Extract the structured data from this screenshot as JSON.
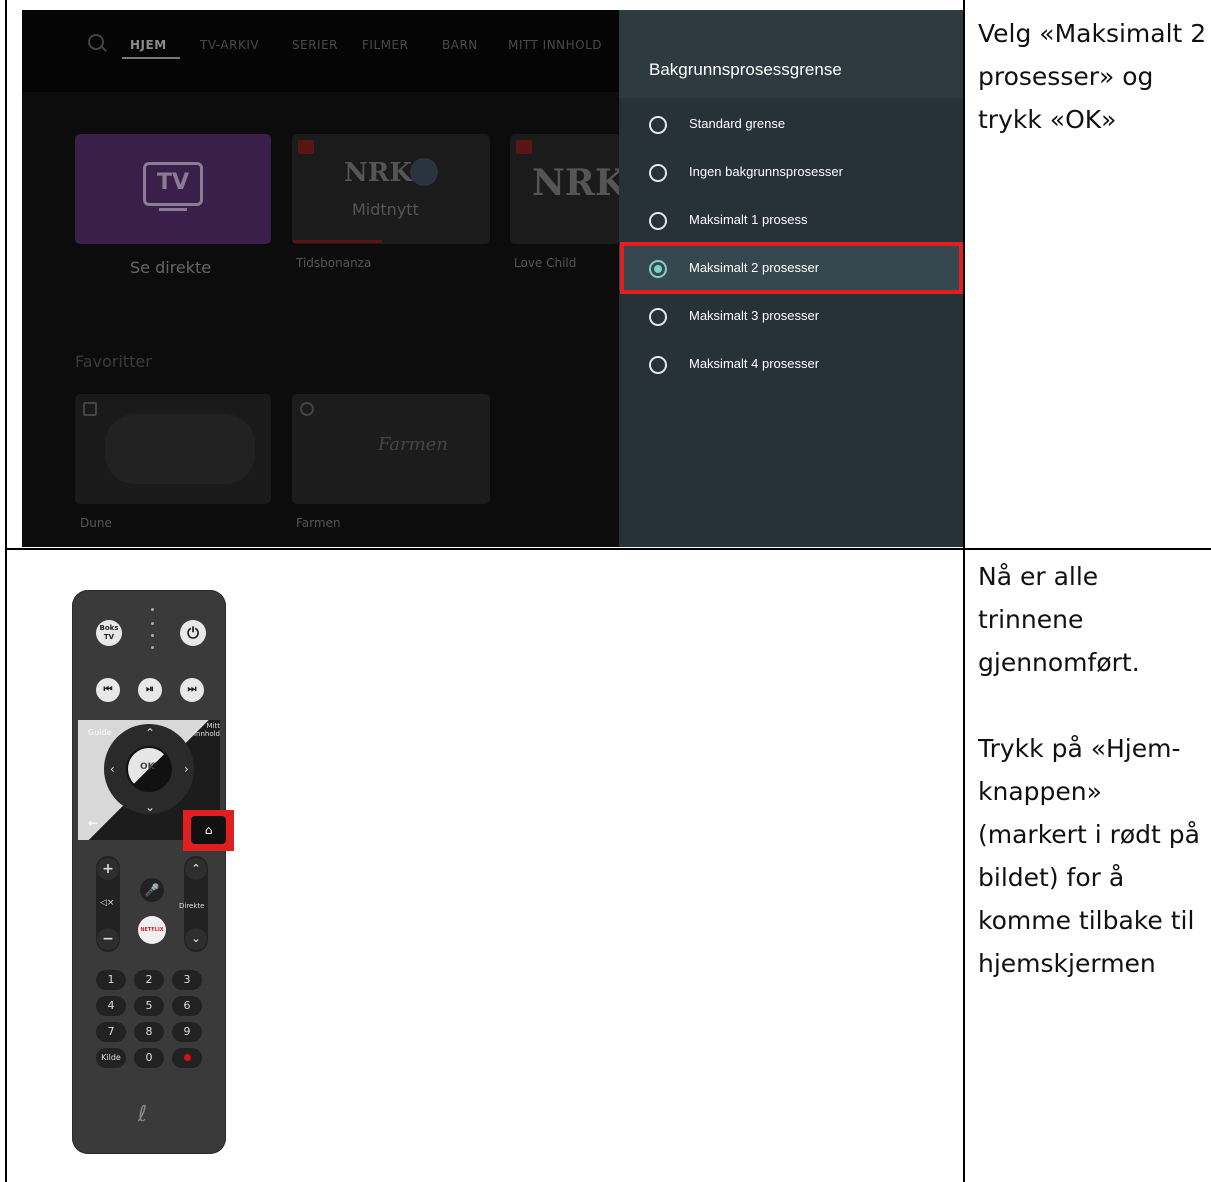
{
  "step1": {
    "instruction": "Velg «Maksimalt 2 prosesser» og trykk «OK»",
    "tv_nav": [
      "HJEM",
      "TV-ARKIV",
      "SERIER",
      "FILMER",
      "BARN",
      "MITT INNHOLD"
    ],
    "tv_nav_active": "HJEM",
    "cards_row1": [
      {
        "tile_text": "TV",
        "label": "Se direkte"
      },
      {
        "tile_text": "Midtnytt",
        "label": "Tidsbonanza"
      },
      {
        "tile_text": "",
        "label": "Love Child"
      }
    ],
    "section_favoritter": "Favoritter",
    "cards_row2": [
      {
        "tile_text": "",
        "label": "Dune"
      },
      {
        "tile_text": "Farmen",
        "label": "Farmen"
      }
    ],
    "panel": {
      "title": "Bakgrunnsprosessgrense",
      "options": [
        {
          "label": "Standard grense",
          "selected": false
        },
        {
          "label": "Ingen bakgrunnsprosesser",
          "selected": false
        },
        {
          "label": "Maksimalt 1 prosess",
          "selected": false
        },
        {
          "label": "Maksimalt 2 prosesser",
          "selected": true
        },
        {
          "label": "Maksimalt 3 prosesser",
          "selected": false
        },
        {
          "label": "Maksimalt 4 prosesser",
          "selected": false
        }
      ]
    }
  },
  "step2": {
    "instruction": "Nå er alle trinnene gjennomført.\n\nTrykk på «Hjem-knappen» (markert i rødt på bildet) for å komme tilbake til hjemskjermen",
    "remote": {
      "boks_tv": "Boks TV",
      "guide": "Guide",
      "mitt_innhold": "Mitt Innhold",
      "ok": "OK",
      "direkte": "Direkte",
      "netflix": "NETFLIX",
      "digits": [
        "1",
        "2",
        "3",
        "4",
        "5",
        "6",
        "7",
        "8",
        "9"
      ],
      "kilde": "Kilde",
      "zero": "0"
    }
  },
  "colors": {
    "highlight": "#e02020",
    "radio_selected": "#7fd0c7",
    "panel_bg": "#263238"
  }
}
